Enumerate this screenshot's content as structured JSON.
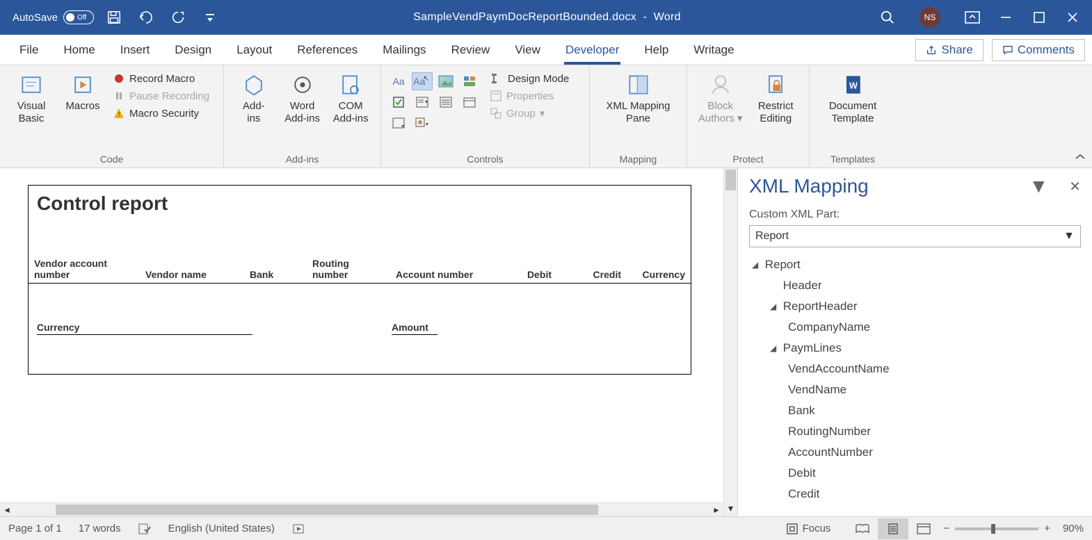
{
  "titlebar": {
    "autosave_label": "AutoSave",
    "autosave_state": "Off",
    "filename": "SampleVendPaymDocReportBounded.docx",
    "app": "Word",
    "user_initials": "NS"
  },
  "tabs": {
    "file": "File",
    "home": "Home",
    "insert": "Insert",
    "design": "Design",
    "layout": "Layout",
    "references": "References",
    "mailings": "Mailings",
    "review": "Review",
    "view": "View",
    "developer": "Developer",
    "help": "Help",
    "writage": "Writage",
    "share": "Share",
    "comments": "Comments"
  },
  "ribbon": {
    "code": {
      "visual_basic": "Visual\nBasic",
      "macros": "Macros",
      "record_macro": "Record Macro",
      "pause_recording": "Pause Recording",
      "macro_security": "Macro Security",
      "group": "Code"
    },
    "addins": {
      "addins": "Add-\nins",
      "word_addins": "Word\nAdd-ins",
      "com_addins": "COM\nAdd-ins",
      "group": "Add-ins"
    },
    "controls": {
      "design_mode": "Design Mode",
      "properties": "Properties",
      "group_btn": "Group",
      "group": "Controls"
    },
    "mapping": {
      "btn": "XML Mapping\nPane",
      "group": "Mapping"
    },
    "protect": {
      "block_authors": "Block\nAuthors",
      "restrict_editing": "Restrict\nEditing",
      "group": "Protect"
    },
    "templates": {
      "doc_template": "Document\nTemplate",
      "group": "Templates"
    }
  },
  "document": {
    "title": "Control report",
    "columns": {
      "vendor_account": "Vendor account number",
      "vendor_name": "Vendor name",
      "bank": "Bank",
      "routing": "Routing number",
      "account": "Account number",
      "debit": "Debit",
      "credit": "Credit",
      "currency": "Currency"
    },
    "summary": {
      "currency": "Currency",
      "amount": "Amount"
    }
  },
  "xml_pane": {
    "title": "XML Mapping",
    "custom_part_label": "Custom XML Part:",
    "selected_part": "Report",
    "tree": {
      "Report": "Report",
      "Header": "Header",
      "ReportHeader": "ReportHeader",
      "CompanyName": "CompanyName",
      "PaymLines": "PaymLines",
      "VendAccountName": "VendAccountName",
      "VendName": "VendName",
      "Bank": "Bank",
      "RoutingNumber": "RoutingNumber",
      "AccountNumber": "AccountNumber",
      "Debit": "Debit",
      "Credit": "Credit"
    }
  },
  "status": {
    "page": "Page 1 of 1",
    "words": "17 words",
    "language": "English (United States)",
    "focus": "Focus",
    "zoom": "90%"
  }
}
